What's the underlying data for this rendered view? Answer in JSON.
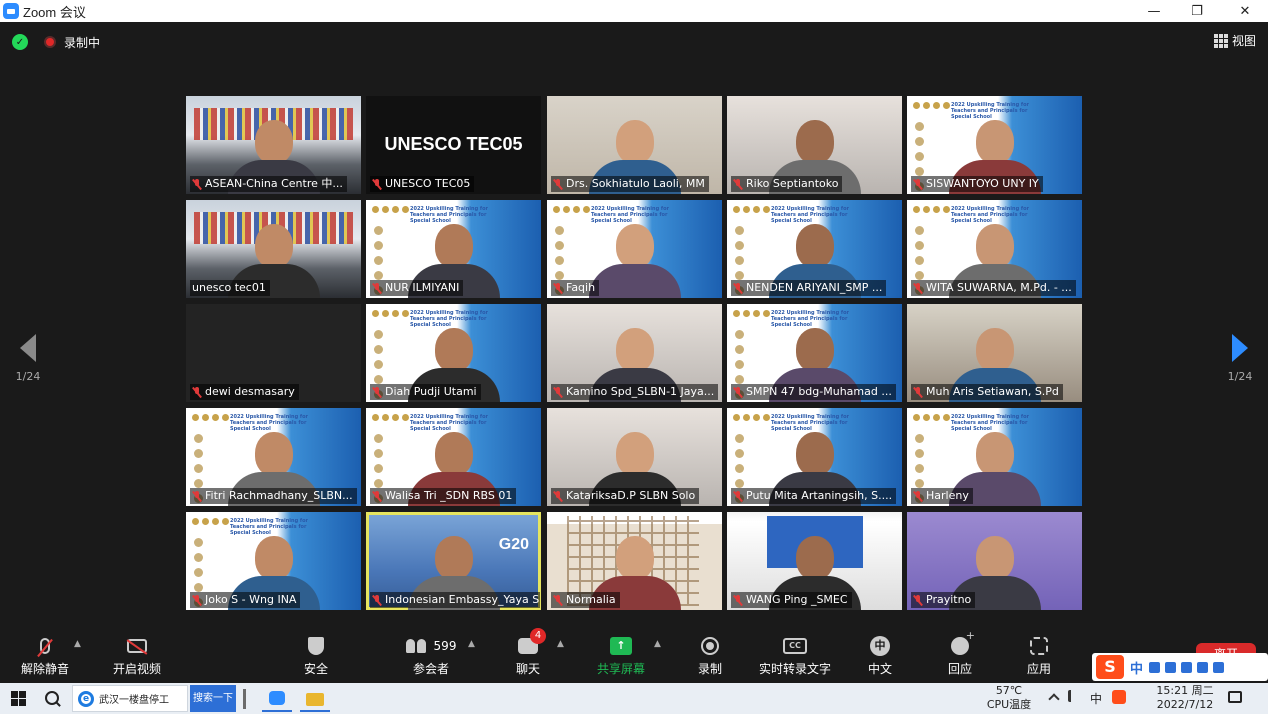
{
  "window": {
    "title": "Zoom 会议",
    "min": "—",
    "restore": "❐",
    "close": "✕"
  },
  "topbar": {
    "recording_label": "录制中",
    "view_label": "视图"
  },
  "pager": {
    "left_page": "1/24",
    "right_page": "1/24"
  },
  "participants": [
    {
      "name": "ASEAN-China Centre 中...",
      "scene": "meeting"
    },
    {
      "name": "UNESCO TEC05",
      "scene": "black",
      "overlay": "UNESCO TEC05"
    },
    {
      "name": "Drs. Sokhiatulo Laoli, MM",
      "scene": "office"
    },
    {
      "name": "Riko Septiantoko",
      "scene": "blur"
    },
    {
      "name": "SISWANTOYO UNY IY",
      "scene": "slide"
    },
    {
      "name": "unesco tec01",
      "scene": "meeting"
    },
    {
      "name": "NUR ILMIYANI",
      "scene": "slide"
    },
    {
      "name": "Faqih",
      "scene": "slide"
    },
    {
      "name": "NENDEN ARIYANI_SMP ...",
      "scene": "slide"
    },
    {
      "name": "WITA SUWARNA, M.Pd. - ...",
      "scene": "slide"
    },
    {
      "name": "dewi desmasary",
      "scene": "dark"
    },
    {
      "name": "Diah Pudji Utami",
      "scene": "slide"
    },
    {
      "name": "Kamino Spd_SLBN-1 Jaya...",
      "scene": "blur"
    },
    {
      "name": "SMPN 47 bdg-Muhamad ...",
      "scene": "slide"
    },
    {
      "name": "Muh Aris Setiawan, S.Pd",
      "scene": "room"
    },
    {
      "name": "Fitri Rachmadhany_SLBN...",
      "scene": "slide"
    },
    {
      "name": "Walisa Tri _SDN RBS 01",
      "scene": "slide"
    },
    {
      "name": "KatariksaD.P SLBN Solo",
      "scene": "blur"
    },
    {
      "name": "Putu Mita Artaningsih, S....",
      "scene": "slide"
    },
    {
      "name": "Harleny",
      "scene": "slide"
    },
    {
      "name": "Joko S - Wng INA",
      "scene": "slide"
    },
    {
      "name": "Indonesian Embassy_Yaya Su...",
      "scene": "g20",
      "overlay": "G20",
      "active": true
    },
    {
      "name": "Normalia",
      "scene": "window"
    },
    {
      "name": "WANG Ping _SMEC",
      "scene": "stage"
    },
    {
      "name": "Prayitno",
      "scene": "purple"
    }
  ],
  "slide_title": "2022 Upskilling Training for Teachers and Principals for Special School",
  "toolbar": {
    "unmute": "解除静音",
    "start_video": "开启视频",
    "security": "安全",
    "participants": "参会者",
    "participants_count": "599",
    "chat": "聊天",
    "chat_badge": "4",
    "share": "共享屏幕",
    "record": "录制",
    "transcript": "实时转录文字",
    "language": "中文",
    "language_icon": "中",
    "reactions": "回应",
    "apps": "应用",
    "leave": "离开"
  },
  "ime": {
    "logo": "S",
    "mode": "中"
  },
  "taskbar": {
    "search_query": "武汉一楼盘停工",
    "search_button": "搜索一下",
    "temperature": "57℃",
    "cpu_label": "CPU温度",
    "ime_indicator": "中",
    "time": "15:21 周二",
    "date": "2022/7/12"
  },
  "colors": {
    "accent": "#2d8cff",
    "share": "#1fb954",
    "leave": "#d92a2a",
    "active_speaker": "#e6e55f"
  }
}
